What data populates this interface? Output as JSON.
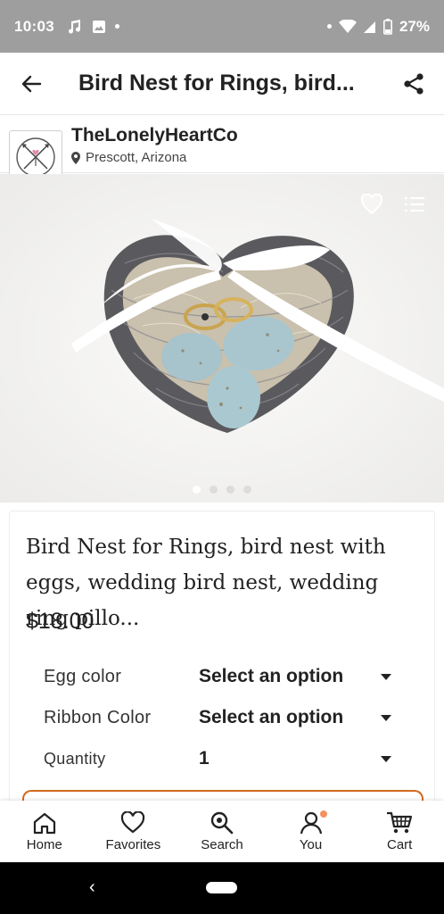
{
  "status_bar": {
    "time": "10:03",
    "battery": "27%"
  },
  "app_bar": {
    "title": "Bird Nest for Rings, bird..."
  },
  "shop": {
    "name": "TheLonelyHeartCo",
    "location": "Prescott, Arizona"
  },
  "gallery": {
    "image_count": 4,
    "active_index": 0
  },
  "listing": {
    "title": "Bird Nest for Rings, bird nest with eggs, wedding bird nest, wedding ring pillo...",
    "price": "$18.00"
  },
  "variations": [
    {
      "label": "Egg color",
      "value": "Select an option"
    },
    {
      "label": "Ribbon Color",
      "value": "Select an option"
    },
    {
      "label": "Quantity",
      "value": "1"
    }
  ],
  "bottom_nav": {
    "items": [
      {
        "label": "Home",
        "icon": "home-icon"
      },
      {
        "label": "Favorites",
        "icon": "heart-icon"
      },
      {
        "label": "Search",
        "icon": "search-icon"
      },
      {
        "label": "You",
        "icon": "person-icon"
      },
      {
        "label": "Cart",
        "icon": "cart-icon"
      }
    ]
  },
  "colors": {
    "accent": "#f1641e",
    "status_bar": "#9e9e9e",
    "buy_outline": "#d2691e"
  }
}
